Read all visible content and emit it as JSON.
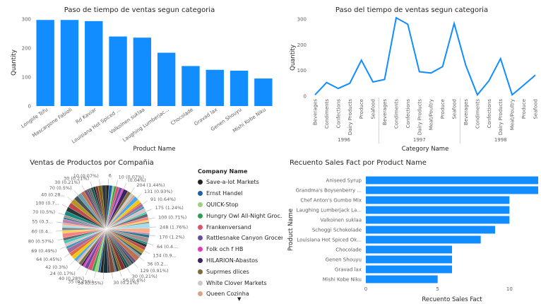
{
  "colors": {
    "bar": "#118DFF",
    "line": "#118DFF",
    "axis": "#605e5c",
    "grid": "#e8e8e8"
  },
  "chart_data": [
    {
      "type": "bar",
      "title": "Paso de tiempo de ventas segun categoria",
      "xlabel": "Product Name",
      "ylabel": "Quantity",
      "ylim": [
        0,
        300
      ],
      "yticks": [
        "0",
        "100",
        "200",
        "300"
      ],
      "categories": [
        "Longlife Tofu",
        "Mascarpone Fabioli",
        "Rd Kaviar",
        "Louisiana Hot Spiced ...",
        "Valkoinen suklaa",
        "Laughing Lumberjac...",
        "Chocolade",
        "Gravad lax",
        "Genen Shouyu",
        "Mishi Kobe Niku"
      ],
      "values": [
        297,
        297,
        293,
        240,
        236,
        184,
        138,
        125,
        122,
        95
      ]
    },
    {
      "type": "line",
      "title": "Paso del tiempo de ventas segun categoria",
      "xlabel": "Category Name",
      "ylabel": "Quantity",
      "ylim": [
        0,
        300
      ],
      "yticks": [
        "0",
        "100",
        "200",
        "300"
      ],
      "x": [
        "Beverages",
        "Condiments",
        "Confections",
        "Dairy Products",
        "Produce",
        "Seafood",
        "Beverages",
        "Condiments",
        "Confections",
        "Dairy Products",
        "Meat/Poultry",
        "Produce",
        "Seafood",
        "Beverages",
        "Condiments",
        "Confections",
        "Dairy Products",
        "Meat/Poultry",
        "Produce",
        "Seafood"
      ],
      "groups": [
        {
          "label": "1996",
          "count": 6
        },
        {
          "label": "1997",
          "count": 7
        },
        {
          "label": "1998",
          "count": 7
        }
      ],
      "values": [
        5,
        53,
        30,
        50,
        140,
        55,
        65,
        305,
        280,
        95,
        90,
        115,
        283,
        120,
        5,
        60,
        146,
        5,
        43,
        82
      ]
    },
    {
      "type": "pie",
      "title": "Ventas de Productos por Compañia",
      "legend_title": "Company Name",
      "legend": [
        {
          "name": "Save-a-lot Markets",
          "color": "#252423"
        },
        {
          "name": "Ernst Handel",
          "color": "#1a5fa8"
        },
        {
          "name": "QUICK-Stop",
          "color": "#9bd27b"
        },
        {
          "name": "Hungry Owl All-Night Groc...",
          "color": "#2e9d4f"
        },
        {
          "name": "Frankenversand",
          "color": "#e04f6b"
        },
        {
          "name": "Rattlesnake Canyon Grocery",
          "color": "#6b4aa3"
        },
        {
          "name": "Folk och f HB",
          "color": "#e23bb6"
        },
        {
          "name": "HILARION-Abastos",
          "color": "#3a2263"
        },
        {
          "name": "Suprmes dlices",
          "color": "#7d6a3c"
        },
        {
          "name": "White Clover Markets",
          "color": "#c9c9c9"
        },
        {
          "name": "Queen Cozinha",
          "color": "#d9a584"
        }
      ],
      "labels": [
        "6",
        "10 (0.07%)",
        "(0.04%)",
        "204 (1.44%)",
        "131 (0.93%)",
        "91 (0.64%)",
        "175 (1.24%)",
        "100 (0.71%)",
        "248 (1.76%)",
        "170 (1.2%)",
        "64 (0.4...",
        "134 (0.9...",
        "36 (0.2...",
        "129 (0.91%)",
        "30 (0.21%)",
        "56 (0.4%)",
        "30 (0.21%)",
        "50 (0.35%)",
        "35 (0.25%)",
        "40 (0.28%)",
        "24 (0.17%)",
        "42 (0.3%)",
        "64 (0.45%)",
        "69 (0.49%)",
        "80 (0.57%)",
        "60 (0.4...",
        "55 (0.3...",
        "70 (0.5%)",
        "100 (0.7...",
        "40 (0.28...",
        "70 (0.5%)",
        "30 (0.21%)",
        "30 (0.21%)",
        "10 (0.07%)"
      ]
    },
    {
      "type": "bar",
      "orientation": "horizontal",
      "title": "Recuento Sales Fact por Product Name",
      "xlabel": "Recuento Sales Fact",
      "ylabel": "Product Name",
      "xlim": [
        0,
        12
      ],
      "xticks": [
        "0",
        "5",
        "10"
      ],
      "categories": [
        "Aniseed Syrup",
        "Grandma's Boysenberry ...",
        "Chef Anton's Gumbo Mix",
        "Laughing Lumberjack La...",
        "Valkoinen suklaa",
        "Schoggi Schokolade",
        "Louisiana Hot Spiced Ok...",
        "Chocolade",
        "Genen Shouyu",
        "Gravad lax",
        "Mishi Kobe Niku"
      ],
      "values": [
        12,
        12,
        10,
        10,
        10,
        9,
        8,
        6,
        6,
        6,
        5
      ]
    }
  ]
}
